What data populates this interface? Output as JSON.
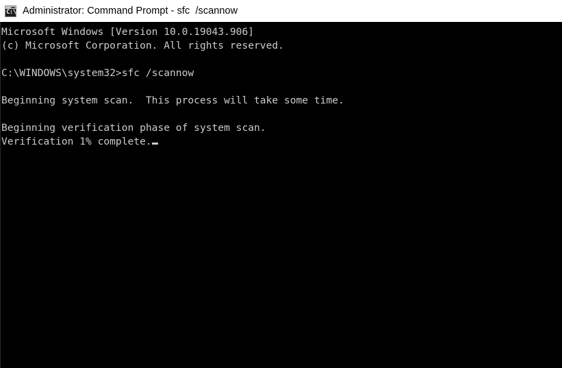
{
  "window": {
    "title": "Administrator: Command Prompt - sfc  /scannow",
    "icon": "command-prompt-icon",
    "icon_glyph": "C:\\",
    "titlebar_bg": "#ffffff",
    "titlebar_fg": "#000000",
    "console_bg": "#000000",
    "console_fg": "#cccccc"
  },
  "console": {
    "lines": [
      {
        "text": "Microsoft Windows [Version 10.0.19043.906]",
        "blank": false
      },
      {
        "text": "(c) Microsoft Corporation. All rights reserved.",
        "blank": false
      },
      {
        "text": "",
        "blank": true
      },
      {
        "text": "C:\\WINDOWS\\system32>sfc /scannow",
        "blank": false
      },
      {
        "text": "",
        "blank": true
      },
      {
        "text": "Beginning system scan.  This process will take some time.",
        "blank": false
      },
      {
        "text": "",
        "blank": true
      },
      {
        "text": "Beginning verification phase of system scan.",
        "blank": false
      },
      {
        "text": "Verification 1% complete.",
        "blank": false
      }
    ],
    "cursor": {
      "visible": true,
      "line_index": 8,
      "style": "underscore-block"
    },
    "prompt_path": "C:\\WINDOWS\\system32",
    "command": "sfc /scannow",
    "progress_percent": 1
  }
}
